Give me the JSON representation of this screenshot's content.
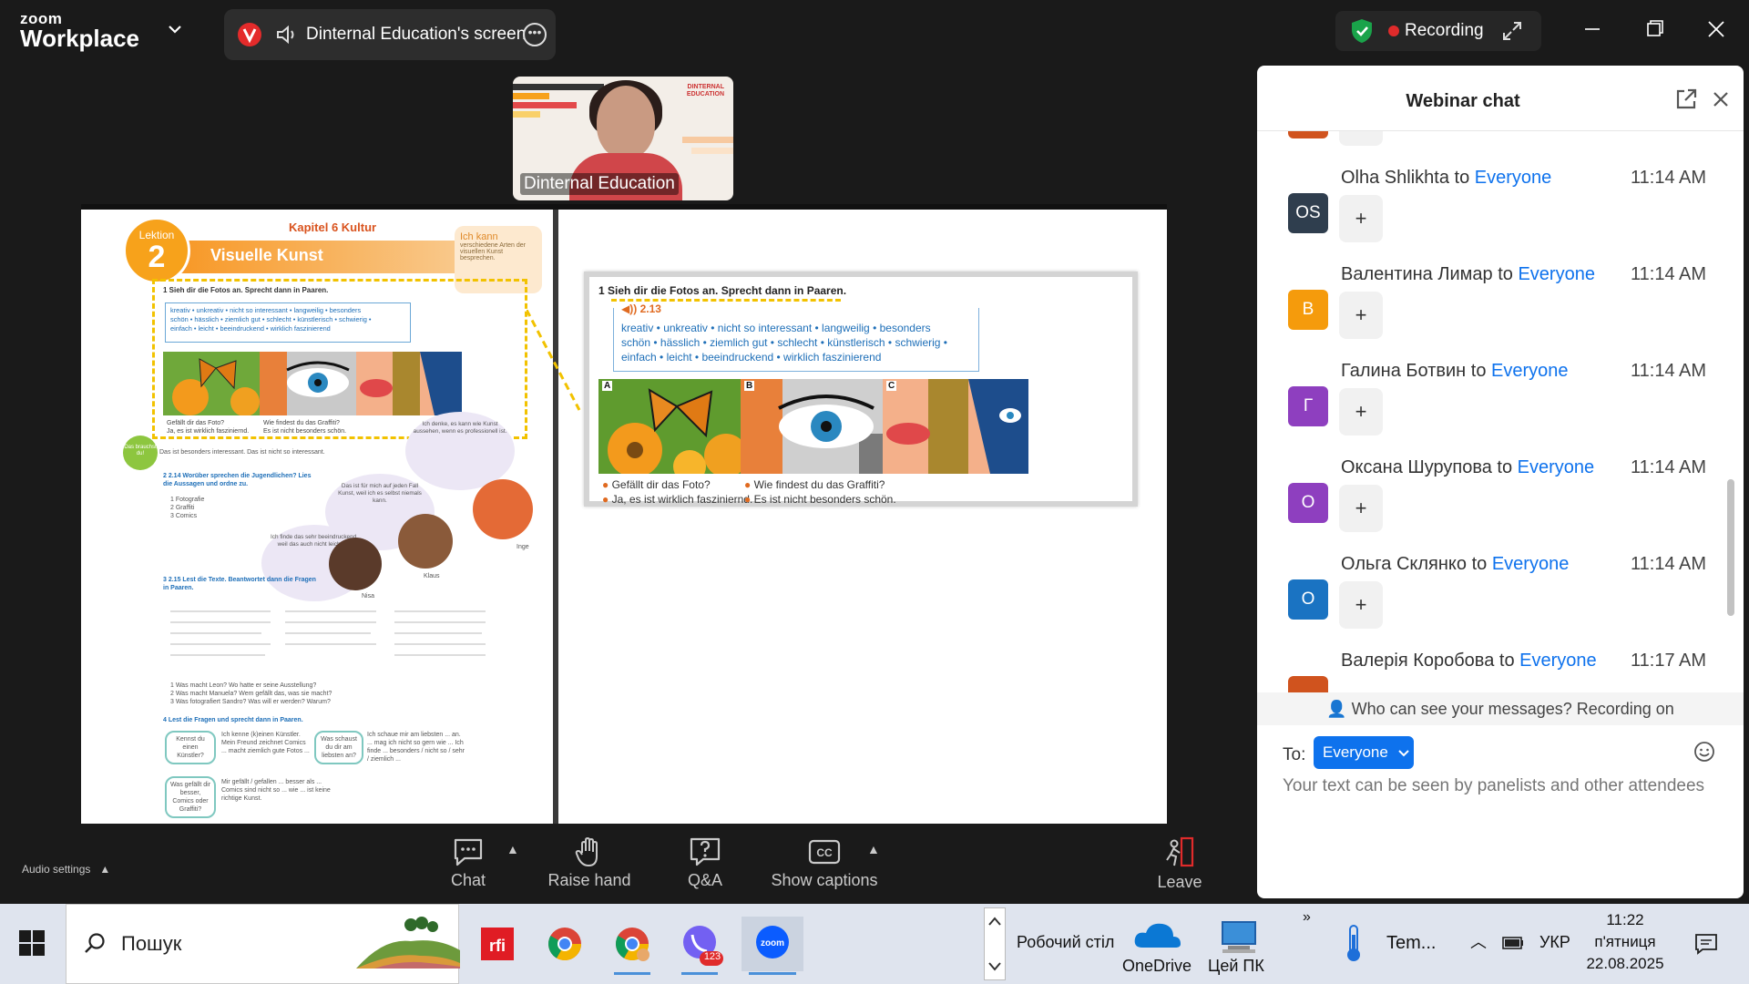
{
  "app": {
    "logo_top": "zoom",
    "logo_bottom": "Workplace",
    "share_title": "Dinternal Education's screen",
    "recording_label": "Recording",
    "colors": {
      "accent": "#0e72ed",
      "record": "#e02b2b",
      "secure": "#1aa34a",
      "background": "#1a1a1a"
    }
  },
  "thumbnail": {
    "name": "Dinternal Education",
    "brand_line1": "DINTERNAL",
    "brand_line2": "EDUCATION"
  },
  "slide": {
    "lektion_label": "Lektion",
    "lektion_number": "2",
    "kapitel": "Kapitel 6 Kultur",
    "lesson_title": "Visuelle Kunst",
    "ich_kann_title": "Ich kann",
    "ich_kann_text": "verschiedene Arten der visuellen Kunst besprechen.",
    "ex1_heading": "1  Sieh dir die Fotos an. Sprecht dann in Paaren.",
    "audio_213": "2.13",
    "words_line1": "kreativ • unkreativ • nicht so interessant • langweilig • besonders",
    "words_line2": "schön • hässlich • ziemlich gut • schlecht • künstlerisch • schwierig •",
    "words_line3": "einfach • leicht • beeindruckend • wirklich faszinierend",
    "photo_a": "A",
    "photo_b": "B",
    "photo_c": "C",
    "cap_a1": "Gefällt dir das Foto?",
    "cap_a2": "Ja, es ist wirklich fasziniernd.",
    "cap_b1": "Wie findest du das Graffiti?",
    "cap_b2": "Es ist nicht besonders schön.",
    "braucht": "Das brauchst du!",
    "braucht_line": "Das ist besonders interessant.   Das ist nicht so interessant.",
    "ex2_heading": "2  2.14 Worüber sprechen die Jugendlichen? Lies die Aussagen und ordne zu.",
    "ex2_items": "1 Fotografie\n2 Graffiti\n3 Comics",
    "bubble1": "Ich denke, es kann wie Kunst aussehen, wenn es professionell ist.",
    "bubble2": "Das ist für mich auf jeden Fall Kunst, weil ich es selbst niemals kann.",
    "bubble3": "Ich finde das sehr beeindruckend, weil das auch nicht leicht ist.",
    "name_inge": "Inge",
    "name_nisa": "Nisa",
    "name_klaus": "Klaus",
    "ex3_heading": "3  2.15 Lest die Texte. Beantwortet dann die Fragen in Paaren.",
    "ex3_questions": "1 Was macht Leon? Wo hatte er seine Ausstellung?\n2 Was macht Manuela? Wem gefällt das, was sie macht?\n3 Was fotografiert Sandro? Was will er werden? Warum?",
    "ex4_heading": "4  Lest die Fragen und sprecht dann in Paaren.",
    "ex4_q1": "Kennst du einen Künstler?",
    "ex4_q2": "Was schaust du dir am liebsten an?",
    "ex4_q3": "Was gefällt dir besser, Comics oder Graffiti?",
    "ex4_a1": "Ich kenne (k)einen Künstler. Mein Freund zeichnet Comics ... macht ziemlich gute Fotos ...",
    "ex4_a2": "Ich schaue mir am liebsten ... an. ... mag ich nicht so gern wie ... Ich finde ... besonders / nicht so / sehr / ziemlich ...",
    "ex4_a3": "Mir gefällt / gefallen ... besser als ... Comics sind nicht so ... wie ... ist keine richtige Kunst."
  },
  "toolbar": {
    "audio_settings": "Audio settings",
    "chat": "Chat",
    "raise_hand": "Raise hand",
    "qa": "Q&A",
    "show_captions": "Show captions",
    "leave": "Leave"
  },
  "chat": {
    "title": "Webinar chat",
    "to_word": "to",
    "react_symbol": "+",
    "messages": [
      {
        "initials": "OS",
        "sender": "Olha Shlikhta",
        "target": "Everyone",
        "time": "11:14 AM",
        "color": "#2f3e4e"
      },
      {
        "initials": "В",
        "sender": "Валентина Лимар",
        "target": "Everyone",
        "time": "11:14 AM",
        "color": "#f59b0c"
      },
      {
        "initials": "Г",
        "sender": "Галина Ботвин",
        "target": "Everyone",
        "time": "11:14 AM",
        "color": "#8e3fbf"
      },
      {
        "initials": "О",
        "sender": "Оксана Шурупова",
        "target": "Everyone",
        "time": "11:14 AM",
        "color": "#8e3fbf"
      },
      {
        "initials": "О",
        "sender": "Ольга Склянко",
        "target": "Everyone",
        "time": "11:14 AM",
        "color": "#1a73c2"
      },
      {
        "initials": "",
        "sender": "Валерія Коробова",
        "target": "Everyone",
        "time": "11:17 AM",
        "color": "#d0531e"
      }
    ],
    "visibility_note": "Who can see your messages? Recording on",
    "to_label": "To:",
    "to_value": "Everyone",
    "input_placeholder": "Your text can be seen by panelists and other attendees"
  },
  "taskbar": {
    "search_label": "Пошук",
    "desktop_label": "Робочий стіл",
    "onedrive_label": "OneDrive",
    "thispc_label": "Цей ПК",
    "weather_label": "Tem...",
    "lang": "УКР",
    "time": "11:22",
    "day": "п'ятниця",
    "date": "22.08.2025",
    "viber_badge": "123"
  }
}
